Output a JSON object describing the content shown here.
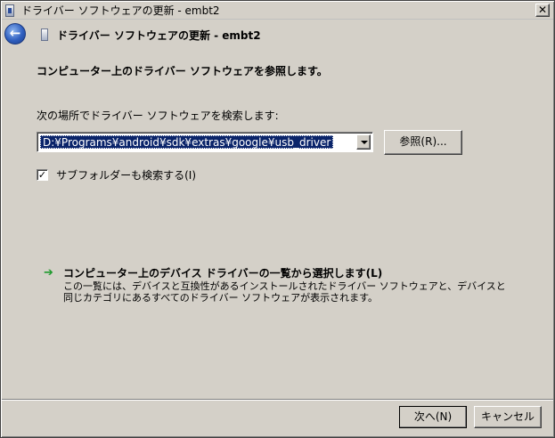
{
  "window": {
    "title": "ドライバー ソフトウェアの更新 - embt2",
    "close_glyph": "✕"
  },
  "header": {
    "back_glyph": "←",
    "title": "ドライバー ソフトウェアの更新 - embt2"
  },
  "content": {
    "heading": "コンピューター上のドライバー ソフトウェアを参照します。",
    "search_label": "次の場所でドライバー ソフトウェアを検索します:",
    "path_value": "D:¥Programs¥android¥sdk¥extras¥google¥usb_driver",
    "browse_label": "参照(R)...",
    "include_subfolders": {
      "checked": true,
      "check_glyph": "✓",
      "label": "サブフォルダーも検索する(I)"
    },
    "pick_link": {
      "arrow_glyph": "➔",
      "label": "コンピューター上のデバイス ドライバーの一覧から選択します(L)",
      "description": "この一覧には、デバイスと互換性があるインストールされたドライバー ソフトウェアと、デバイスと同じカテゴリにあるすべてのドライバー ソフトウェアが表示されます。"
    }
  },
  "footer": {
    "next_label": "次へ(N)",
    "cancel_label": "キャンセル"
  },
  "icons": {
    "window_icon": "device-manager-icon",
    "header_icon": "device-icon",
    "back": "back-arrow-icon",
    "close": "close-icon",
    "combo_dropdown": "chevron-down-icon",
    "link_arrow": "green-arrow-icon"
  }
}
